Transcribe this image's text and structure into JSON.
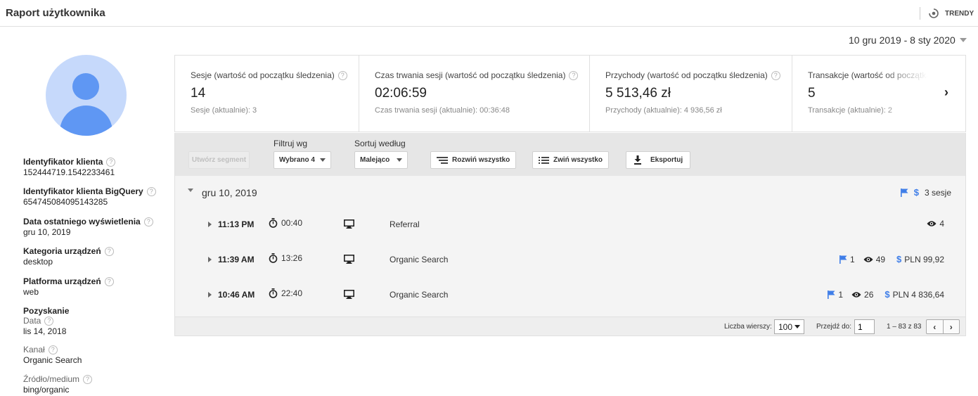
{
  "header": {
    "title": "Raport użytkownika",
    "trends_label": "TRENDY"
  },
  "date_range": "10 gru 2019 - 8 sty 2020",
  "user_info": [
    {
      "label": "Identyfikator klienta",
      "value": "152444719.1542233461",
      "help": true
    },
    {
      "label": "Identyfikator klienta BigQuery",
      "value": "654745084095143285",
      "help": true
    },
    {
      "label": "Data ostatniego wyświetlenia",
      "value": "gru 10, 2019",
      "help": true
    },
    {
      "label": "Kategoria urządzeń",
      "value": "desktop",
      "help": true
    },
    {
      "label": "Platforma urządzeń",
      "value": "web",
      "help": true
    },
    {
      "label": "Pozyskanie",
      "sublabel": "Data",
      "value": "lis 14, 2018",
      "help": true
    },
    {
      "label": "Kanał",
      "value": "Organic Search",
      "help": true,
      "light": true
    },
    {
      "label": "Źródło/medium",
      "value": "bing/organic",
      "help": true,
      "light": true
    }
  ],
  "metrics": [
    {
      "label": "Sesje (wartość od początku śledzenia)",
      "value": "14",
      "sub": "Sesje (aktualnie): 3"
    },
    {
      "label": "Czas trwania sesji (wartość od początku śledzenia)",
      "value": "02:06:59",
      "sub": "Czas trwania sesji (aktualnie): 00:36:48"
    },
    {
      "label": "Przychody (wartość od początku śledzenia)",
      "value": "5 513,46 zł",
      "sub": "Przychody (aktualnie): 4 936,56 zł"
    },
    {
      "label": "Transakcje (wartość od początku śledzenia)",
      "value": "5",
      "sub": "Transakcje (aktualnie): 2"
    }
  ],
  "toolbar": {
    "create_segment": "Utwórz segment",
    "filter_label": "Filtruj wg",
    "filter_value": "Wybrano 4",
    "sort_label": "Sortuj według",
    "sort_value": "Malejąco",
    "expand_all": "Rozwiń wszystko",
    "collapse_all": "Zwiń wszystko",
    "export": "Eksportuj"
  },
  "day": {
    "date": "gru 10, 2019",
    "sessions": "3 sesje"
  },
  "sessions": [
    {
      "time": "11:13 PM",
      "duration": "00:40",
      "channel": "Referral",
      "goals": null,
      "pageviews": "4",
      "revenue": null
    },
    {
      "time": "11:39 AM",
      "duration": "13:26",
      "channel": "Organic Search",
      "goals": "1",
      "pageviews": "49",
      "revenue": "PLN 99,92"
    },
    {
      "time": "10:46 AM",
      "duration": "22:40",
      "channel": "Organic Search",
      "goals": "1",
      "pageviews": "26",
      "revenue": "PLN 4 836,64"
    }
  ],
  "pagination": {
    "rows_label": "Liczba wierszy:",
    "rows_value": "100",
    "goto_label": "Przejdź do:",
    "goto_value": "1",
    "range": "1 – 83 z 83",
    "prev": "‹",
    "next": "›"
  },
  "colors": {
    "accent": "#3f7ee8",
    "avatar_bg": "#c6d9fb",
    "avatar_fg": "#5f97f3"
  },
  "icons": {
    "trends": "trends-icon",
    "timer": "stopwatch-icon",
    "device": "desktop-icon",
    "goal": "flag-icon",
    "views": "eye-icon",
    "revenue": "dollar-icon"
  }
}
